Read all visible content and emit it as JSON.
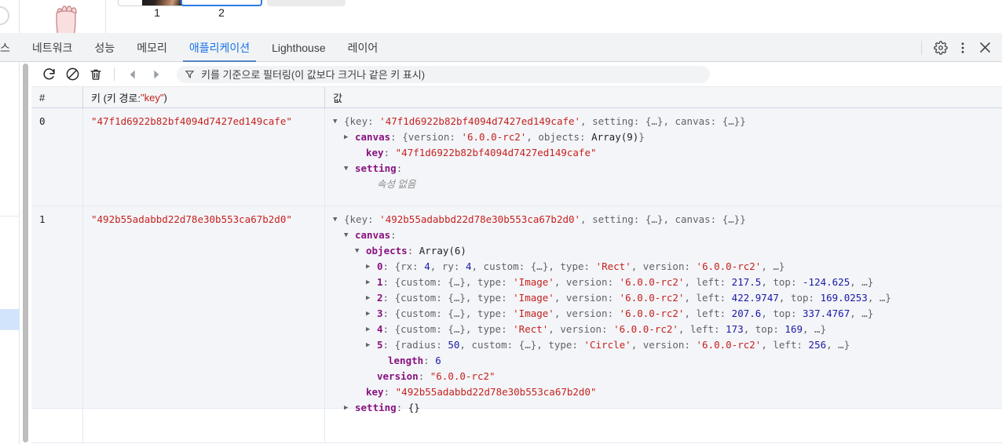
{
  "page_strip": {
    "thumbnails": [
      {
        "label": "1"
      },
      {
        "label": "2"
      }
    ]
  },
  "tabbar": {
    "tabs": [
      {
        "label": "스",
        "active": false
      },
      {
        "label": "네트워크",
        "active": false
      },
      {
        "label": "성능",
        "active": false
      },
      {
        "label": "메모리",
        "active": false
      },
      {
        "label": "애플리케이션",
        "active": true
      },
      {
        "label": "Lighthouse",
        "active": false
      },
      {
        "label": "레이어",
        "active": false
      }
    ],
    "actions": [
      {
        "name": "settings-icon"
      },
      {
        "name": "more-options-icon"
      },
      {
        "name": "close-icon"
      }
    ]
  },
  "toolbar": {
    "refresh_title": "새로고침",
    "clear_title": "지우기",
    "delete_title": "선택한 항목 삭제",
    "prev_title": "이전 페이지",
    "next_title": "다음 페이지",
    "filter_placeholder": "키를 기준으로 필터링(이 값보다 크거나 같은 키 표시)"
  },
  "grid": {
    "headers": {
      "index": "#",
      "key_prefix": "키 (키 경로: ",
      "key_path": "\"key\"",
      "key_suffix": ")",
      "value": "값"
    },
    "rows": [
      {
        "index": "0",
        "key": "\"47f1d6922b82bf4094d7427ed149cafe\"",
        "value_summary": {
          "open_brace": "{",
          "k_key": "key",
          "colon": ": ",
          "v_key": "'47f1d6922b82bf4094d7427ed149cafe'",
          "sep1": ", ",
          "k_setting": "setting",
          "v_setting": "{…}",
          "sep2": ", ",
          "k_canvas": "canvas",
          "v_canvas": "{…}",
          "close_brace": "}"
        },
        "tree": [
          {
            "indent": 1,
            "marker": "closed",
            "prop": "canvas",
            "rest_dim": ": {version: ",
            "parts": [
              {
                "t": "dim",
                "s": ": {"
              },
              {
                "t": "dim",
                "s": "version"
              },
              {
                "t": "dim",
                "s": ": "
              },
              {
                "t": "str",
                "s": "'6.0.0-rc2'"
              },
              {
                "t": "dim",
                "s": ", "
              },
              {
                "t": "dim",
                "s": "objects"
              },
              {
                "t": "dim",
                "s": ": "
              },
              {
                "t": "plain",
                "s": "Array(9)"
              },
              {
                "t": "dim",
                "s": "}"
              }
            ]
          },
          {
            "indent": 2,
            "marker": "none",
            "prop": "key",
            "parts": [
              {
                "t": "dim",
                "s": ": "
              },
              {
                "t": "str",
                "s": "\"47f1d6922b82bf4094d7427ed149cafe\""
              }
            ]
          },
          {
            "indent": 1,
            "marker": "open",
            "prop": "setting",
            "parts": [
              {
                "t": "dim",
                "s": ":"
              }
            ]
          },
          {
            "indent": 3,
            "marker": "none",
            "prop": "",
            "parts": [
              {
                "t": "none",
                "s": "속성 없음"
              }
            ]
          }
        ]
      },
      {
        "index": "1",
        "key": "\"492b55adabbd22d78e30b553ca67b2d0\"",
        "value_summary": {
          "open_brace": "{",
          "k_key": "key",
          "colon": ": ",
          "v_key": "'492b55adabbd22d78e30b553ca67b2d0'",
          "sep1": ", ",
          "k_setting": "setting",
          "v_setting": "{…}",
          "sep2": ", ",
          "k_canvas": "canvas",
          "v_canvas": "{…}",
          "close_brace": "}"
        },
        "tree": [
          {
            "indent": 1,
            "marker": "open",
            "prop": "canvas",
            "parts": [
              {
                "t": "dim",
                "s": ":"
              }
            ]
          },
          {
            "indent": 2,
            "marker": "open",
            "prop": "objects",
            "parts": [
              {
                "t": "dim",
                "s": ": "
              },
              {
                "t": "plain",
                "s": "Array(6)"
              }
            ]
          },
          {
            "indent": 3,
            "marker": "closed",
            "prop": "0",
            "parts": [
              {
                "t": "dim",
                "s": ": {"
              },
              {
                "t": "dim",
                "s": "rx"
              },
              {
                "t": "dim",
                "s": ": "
              },
              {
                "t": "num",
                "s": "4"
              },
              {
                "t": "dim",
                "s": ", "
              },
              {
                "t": "dim",
                "s": "ry"
              },
              {
                "t": "dim",
                "s": ": "
              },
              {
                "t": "num",
                "s": "4"
              },
              {
                "t": "dim",
                "s": ", "
              },
              {
                "t": "dim",
                "s": "custom"
              },
              {
                "t": "dim",
                "s": ": "
              },
              {
                "t": "dim",
                "s": "{…}"
              },
              {
                "t": "dim",
                "s": ", "
              },
              {
                "t": "dim",
                "s": "type"
              },
              {
                "t": "dim",
                "s": ": "
              },
              {
                "t": "str",
                "s": "'Rect'"
              },
              {
                "t": "dim",
                "s": ", "
              },
              {
                "t": "dim",
                "s": "version"
              },
              {
                "t": "dim",
                "s": ": "
              },
              {
                "t": "str",
                "s": "'6.0.0-rc2'"
              },
              {
                "t": "dim",
                "s": ", …}"
              }
            ]
          },
          {
            "indent": 3,
            "marker": "closed",
            "prop": "1",
            "parts": [
              {
                "t": "dim",
                "s": ": {"
              },
              {
                "t": "dim",
                "s": "custom"
              },
              {
                "t": "dim",
                "s": ": "
              },
              {
                "t": "dim",
                "s": "{…}"
              },
              {
                "t": "dim",
                "s": ", "
              },
              {
                "t": "dim",
                "s": "type"
              },
              {
                "t": "dim",
                "s": ": "
              },
              {
                "t": "str",
                "s": "'Image'"
              },
              {
                "t": "dim",
                "s": ", "
              },
              {
                "t": "dim",
                "s": "version"
              },
              {
                "t": "dim",
                "s": ": "
              },
              {
                "t": "str",
                "s": "'6.0.0-rc2'"
              },
              {
                "t": "dim",
                "s": ", "
              },
              {
                "t": "dim",
                "s": "left"
              },
              {
                "t": "dim",
                "s": ": "
              },
              {
                "t": "num",
                "s": "217.5"
              },
              {
                "t": "dim",
                "s": ", "
              },
              {
                "t": "dim",
                "s": "top"
              },
              {
                "t": "dim",
                "s": ": "
              },
              {
                "t": "num",
                "s": "-124.625"
              },
              {
                "t": "dim",
                "s": ", …}"
              }
            ]
          },
          {
            "indent": 3,
            "marker": "closed",
            "prop": "2",
            "parts": [
              {
                "t": "dim",
                "s": ": {"
              },
              {
                "t": "dim",
                "s": "custom"
              },
              {
                "t": "dim",
                "s": ": "
              },
              {
                "t": "dim",
                "s": "{…}"
              },
              {
                "t": "dim",
                "s": ", "
              },
              {
                "t": "dim",
                "s": "type"
              },
              {
                "t": "dim",
                "s": ": "
              },
              {
                "t": "str",
                "s": "'Image'"
              },
              {
                "t": "dim",
                "s": ", "
              },
              {
                "t": "dim",
                "s": "version"
              },
              {
                "t": "dim",
                "s": ": "
              },
              {
                "t": "str",
                "s": "'6.0.0-rc2'"
              },
              {
                "t": "dim",
                "s": ", "
              },
              {
                "t": "dim",
                "s": "left"
              },
              {
                "t": "dim",
                "s": ": "
              },
              {
                "t": "num",
                "s": "422.9747"
              },
              {
                "t": "dim",
                "s": ", "
              },
              {
                "t": "dim",
                "s": "top"
              },
              {
                "t": "dim",
                "s": ": "
              },
              {
                "t": "num",
                "s": "169.0253"
              },
              {
                "t": "dim",
                "s": ", …}"
              }
            ]
          },
          {
            "indent": 3,
            "marker": "closed",
            "prop": "3",
            "parts": [
              {
                "t": "dim",
                "s": ": {"
              },
              {
                "t": "dim",
                "s": "custom"
              },
              {
                "t": "dim",
                "s": ": "
              },
              {
                "t": "dim",
                "s": "{…}"
              },
              {
                "t": "dim",
                "s": ", "
              },
              {
                "t": "dim",
                "s": "type"
              },
              {
                "t": "dim",
                "s": ": "
              },
              {
                "t": "str",
                "s": "'Image'"
              },
              {
                "t": "dim",
                "s": ", "
              },
              {
                "t": "dim",
                "s": "version"
              },
              {
                "t": "dim",
                "s": ": "
              },
              {
                "t": "str",
                "s": "'6.0.0-rc2'"
              },
              {
                "t": "dim",
                "s": ", "
              },
              {
                "t": "dim",
                "s": "left"
              },
              {
                "t": "dim",
                "s": ": "
              },
              {
                "t": "num",
                "s": "207.6"
              },
              {
                "t": "dim",
                "s": ", "
              },
              {
                "t": "dim",
                "s": "top"
              },
              {
                "t": "dim",
                "s": ": "
              },
              {
                "t": "num",
                "s": "337.4767"
              },
              {
                "t": "dim",
                "s": ", …}"
              }
            ]
          },
          {
            "indent": 3,
            "marker": "closed",
            "prop": "4",
            "parts": [
              {
                "t": "dim",
                "s": ": {"
              },
              {
                "t": "dim",
                "s": "custom"
              },
              {
                "t": "dim",
                "s": ": "
              },
              {
                "t": "dim",
                "s": "{…}"
              },
              {
                "t": "dim",
                "s": ", "
              },
              {
                "t": "dim",
                "s": "type"
              },
              {
                "t": "dim",
                "s": ": "
              },
              {
                "t": "str",
                "s": "'Rect'"
              },
              {
                "t": "dim",
                "s": ", "
              },
              {
                "t": "dim",
                "s": "version"
              },
              {
                "t": "dim",
                "s": ": "
              },
              {
                "t": "str",
                "s": "'6.0.0-rc2'"
              },
              {
                "t": "dim",
                "s": ", "
              },
              {
                "t": "dim",
                "s": "left"
              },
              {
                "t": "dim",
                "s": ": "
              },
              {
                "t": "num",
                "s": "173"
              },
              {
                "t": "dim",
                "s": ", "
              },
              {
                "t": "dim",
                "s": "top"
              },
              {
                "t": "dim",
                "s": ": "
              },
              {
                "t": "num",
                "s": "169"
              },
              {
                "t": "dim",
                "s": ", …}"
              }
            ]
          },
          {
            "indent": 3,
            "marker": "closed",
            "prop": "5",
            "parts": [
              {
                "t": "dim",
                "s": ": {"
              },
              {
                "t": "dim",
                "s": "radius"
              },
              {
                "t": "dim",
                "s": ": "
              },
              {
                "t": "num",
                "s": "50"
              },
              {
                "t": "dim",
                "s": ", "
              },
              {
                "t": "dim",
                "s": "custom"
              },
              {
                "t": "dim",
                "s": ": "
              },
              {
                "t": "dim",
                "s": "{…}"
              },
              {
                "t": "dim",
                "s": ", "
              },
              {
                "t": "dim",
                "s": "type"
              },
              {
                "t": "dim",
                "s": ": "
              },
              {
                "t": "str",
                "s": "'Circle'"
              },
              {
                "t": "dim",
                "s": ", "
              },
              {
                "t": "dim",
                "s": "version"
              },
              {
                "t": "dim",
                "s": ": "
              },
              {
                "t": "str",
                "s": "'6.0.0-rc2'"
              },
              {
                "t": "dim",
                "s": ", "
              },
              {
                "t": "dim",
                "s": "left"
              },
              {
                "t": "dim",
                "s": ": "
              },
              {
                "t": "num",
                "s": "256"
              },
              {
                "t": "dim",
                "s": ", …}"
              }
            ]
          },
          {
            "indent": 4,
            "marker": "none",
            "prop": "length",
            "parts": [
              {
                "t": "dim",
                "s": ": "
              },
              {
                "t": "num",
                "s": "6"
              }
            ]
          },
          {
            "indent": 3,
            "marker": "none",
            "prop": "version",
            "parts": [
              {
                "t": "dim",
                "s": ": "
              },
              {
                "t": "str",
                "s": "\"6.0.0-rc2\""
              }
            ]
          },
          {
            "indent": 2,
            "marker": "none",
            "prop": "key",
            "parts": [
              {
                "t": "dim",
                "s": ": "
              },
              {
                "t": "str",
                "s": "\"492b55adabbd22d78e30b553ca67b2d0\""
              }
            ]
          },
          {
            "indent": 1,
            "marker": "closed",
            "prop": "setting",
            "parts": [
              {
                "t": "dim",
                "s": ": "
              },
              {
                "t": "plain",
                "s": "{}"
              }
            ]
          }
        ]
      }
    ]
  },
  "colors": {
    "accent": "#1a73e8",
    "string": "#c5221f",
    "property": "#881280",
    "number": "#1a1aa6",
    "dim": "#5f6368",
    "row_bg": "#f4f5f8",
    "selection": "#d2e3fc"
  }
}
